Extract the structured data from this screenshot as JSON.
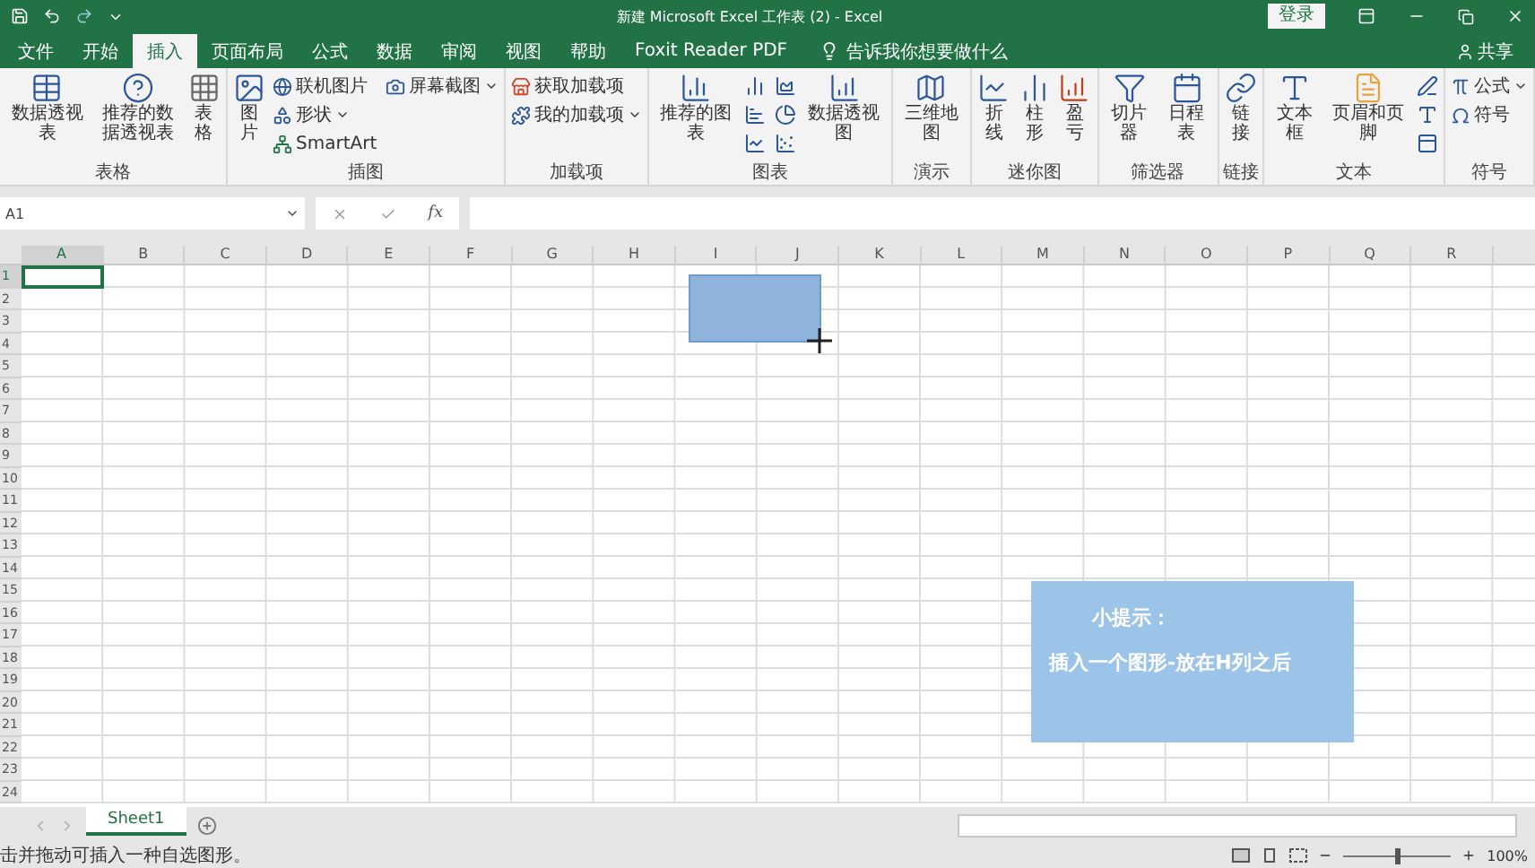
{
  "window": {
    "title": "新建 Microsoft Excel 工作表 (2)  -  Excel",
    "sign_in": "登录"
  },
  "tabs": [
    {
      "label": "文件",
      "selected": false
    },
    {
      "label": "开始",
      "selected": false
    },
    {
      "label": "插入",
      "selected": true
    },
    {
      "label": "页面布局",
      "selected": false
    },
    {
      "label": "公式",
      "selected": false
    },
    {
      "label": "数据",
      "selected": false
    },
    {
      "label": "审阅",
      "selected": false
    },
    {
      "label": "视图",
      "selected": false
    },
    {
      "label": "帮助",
      "selected": false
    },
    {
      "label": "Foxit Reader PDF",
      "selected": false
    }
  ],
  "tell_me": {
    "placeholder": "告诉我你想要做什么"
  },
  "share": "共享",
  "ribbon": [
    {
      "label": "表格",
      "items": [
        {
          "kind": "large",
          "label": "数据透视表"
        },
        {
          "kind": "large",
          "label": "推荐的数据透视表"
        },
        {
          "kind": "large",
          "label": "表格"
        }
      ]
    },
    {
      "label": "插图",
      "items": [
        {
          "kind": "large",
          "label": "图片"
        },
        {
          "kind": "small",
          "label": "联机图片"
        },
        {
          "kind": "small",
          "label": "形状",
          "menu": true
        },
        {
          "kind": "small",
          "label": "SmartArt"
        },
        {
          "kind": "small",
          "label": "屏幕截图",
          "menu": true
        }
      ]
    },
    {
      "label": "加载项",
      "items": [
        {
          "kind": "small",
          "label": "获取加载项"
        },
        {
          "kind": "small",
          "label": "我的加载项",
          "menu": true
        }
      ]
    },
    {
      "label": "图表",
      "items": [
        {
          "kind": "large",
          "label": "推荐的图表"
        },
        {
          "kind": "icon"
        },
        {
          "kind": "icon"
        },
        {
          "kind": "icon"
        },
        {
          "kind": "icon"
        },
        {
          "kind": "icon"
        },
        {
          "kind": "icon"
        },
        {
          "kind": "large",
          "label": "数据透视图"
        }
      ]
    },
    {
      "label": "演示",
      "items": [
        {
          "kind": "large",
          "label": "三维地图"
        }
      ]
    },
    {
      "label": "迷你图",
      "items": [
        {
          "kind": "large",
          "label": "折线"
        },
        {
          "kind": "large",
          "label": "柱形"
        },
        {
          "kind": "large",
          "label": "盈亏"
        }
      ]
    },
    {
      "label": "筛选器",
      "items": [
        {
          "kind": "large",
          "label": "切片器"
        },
        {
          "kind": "large",
          "label": "日程表"
        }
      ]
    },
    {
      "label": "链接",
      "items": [
        {
          "kind": "large",
          "label": "链接"
        }
      ]
    },
    {
      "label": "文本",
      "items": [
        {
          "kind": "large",
          "label": "文本框"
        },
        {
          "kind": "large",
          "label": "页眉和页脚"
        },
        {
          "kind": "icon"
        },
        {
          "kind": "icon"
        },
        {
          "kind": "icon"
        }
      ]
    },
    {
      "label": "符号",
      "items": [
        {
          "kind": "small",
          "label": "公式",
          "menu": true
        },
        {
          "kind": "small",
          "label": "符号"
        }
      ]
    }
  ],
  "formula_bar": {
    "name_box": "A1",
    "fx": "fx"
  },
  "columns": [
    {
      "label": "A",
      "selected": true
    },
    {
      "label": "B",
      "selected": false
    },
    {
      "label": "C",
      "selected": false
    },
    {
      "label": "D",
      "selected": false
    },
    {
      "label": "E",
      "selected": false
    },
    {
      "label": "F",
      "selected": false
    },
    {
      "label": "G",
      "selected": false
    },
    {
      "label": "H",
      "selected": false
    },
    {
      "label": "I",
      "selected": false
    },
    {
      "label": "J",
      "selected": false
    },
    {
      "label": "K",
      "selected": false
    },
    {
      "label": "L",
      "selected": false
    },
    {
      "label": "M",
      "selected": false
    },
    {
      "label": "N",
      "selected": false
    },
    {
      "label": "O",
      "selected": false
    },
    {
      "label": "P",
      "selected": false
    },
    {
      "label": "Q",
      "selected": false
    },
    {
      "label": "R",
      "selected": false
    }
  ],
  "rows": [
    {
      "label": "1",
      "selected": true
    },
    {
      "label": "2",
      "selected": false
    },
    {
      "label": "3",
      "selected": false
    },
    {
      "label": "4",
      "selected": false
    },
    {
      "label": "5",
      "selected": false
    },
    {
      "label": "6",
      "selected": false
    },
    {
      "label": "7",
      "selected": false
    },
    {
      "label": "8",
      "selected": false
    },
    {
      "label": "9",
      "selected": false
    },
    {
      "label": "10",
      "selected": false
    },
    {
      "label": "11",
      "selected": false
    },
    {
      "label": "12",
      "selected": false
    },
    {
      "label": "13",
      "selected": false
    },
    {
      "label": "14",
      "selected": false
    },
    {
      "label": "15",
      "selected": false
    },
    {
      "label": "16",
      "selected": false
    },
    {
      "label": "17",
      "selected": false
    },
    {
      "label": "18",
      "selected": false
    },
    {
      "label": "19",
      "selected": false
    },
    {
      "label": "20",
      "selected": false
    },
    {
      "label": "21",
      "selected": false
    },
    {
      "label": "22",
      "selected": false
    },
    {
      "label": "23",
      "selected": false
    },
    {
      "label": "24",
      "selected": false
    }
  ],
  "tip": {
    "title": "小提示：",
    "text": "插入一个图形-放在H列之后"
  },
  "sheets": [
    {
      "label": "Sheet1",
      "selected": true
    }
  ],
  "status": {
    "message": "击并拖动可插入一种自选图形。",
    "zoom": "100%",
    "level": 0.5
  }
}
